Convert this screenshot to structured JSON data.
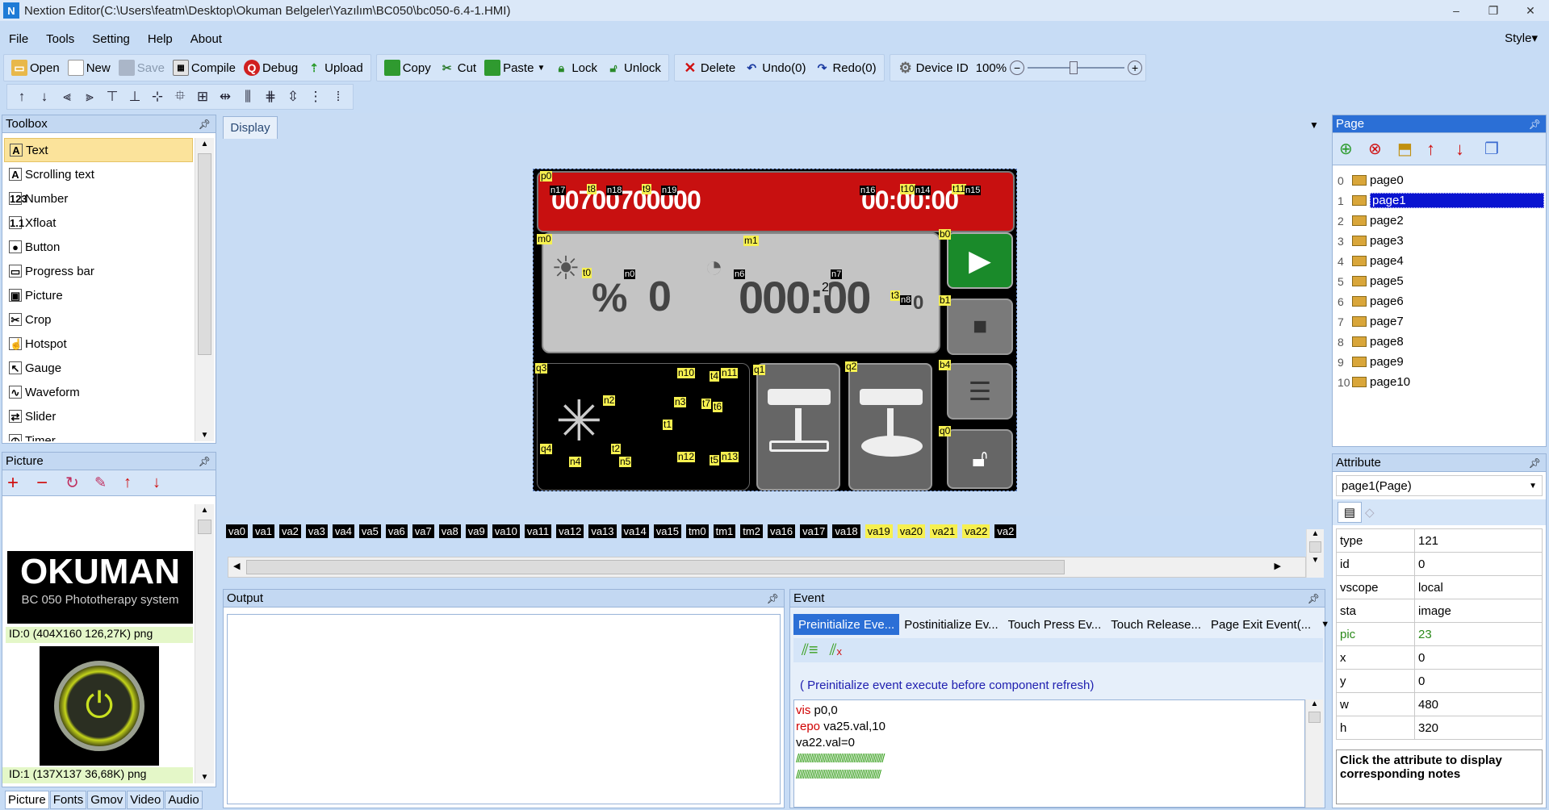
{
  "window": {
    "title": "Nextion Editor(C:\\Users\\featm\\Desktop\\Okuman Belgeler\\Yazılım\\BC050\\bc050-6.4-1.HMI)",
    "app_icon": "N",
    "minimize": "–",
    "maximize": "❐",
    "close": "✕"
  },
  "menu": {
    "file": "File",
    "tools": "Tools",
    "setting": "Setting",
    "help": "Help",
    "about": "About",
    "style": "Style▾"
  },
  "toolbar": {
    "open": "Open",
    "new": "New",
    "save": "Save",
    "compile": "Compile",
    "debug": "Debug",
    "upload": "Upload",
    "copy": "Copy",
    "cut": "Cut",
    "paste": "Paste",
    "lock": "Lock",
    "unlock": "Unlock",
    "delete": "Delete",
    "undo": "Undo(0)",
    "redo": "Redo(0)",
    "device_id": "Device  ID",
    "zoom": "100%"
  },
  "toolbox": {
    "title": "Toolbox",
    "items": [
      "Text",
      "Scrolling text",
      "Number",
      "Xfloat",
      "Button",
      "Progress bar",
      "Picture",
      "Crop",
      "Hotspot",
      "Gauge",
      "Waveform",
      "Slider",
      "Timer"
    ],
    "icons": [
      "A",
      "A",
      "123",
      "1.1",
      "●",
      "▭",
      "▣",
      "✂",
      "☝",
      "↖",
      "∿",
      "⇄",
      "◷"
    ]
  },
  "picture_panel": {
    "title": "Picture",
    "logo_text": "OKUMAN",
    "logo_subtitle": "BC 050 Phototherapy system",
    "pic0_caption": "ID:0  (404X160 126,27K) png",
    "pic1_caption": "ID:1  (137X137 36,68K) png"
  },
  "bottom_tabs": [
    "Picture",
    "Fonts",
    "Gmov",
    "Video",
    "Audio"
  ],
  "display": {
    "tab": "Display",
    "top_digits_left": "00700700000",
    "top_digits_right": "00:00:00",
    "pct_symbol": "%",
    "pct_value": "0",
    "time_value": "000:00",
    "sub_value": "2",
    "sub_value2": "0",
    "labels": {
      "p0": "p0",
      "n17": "n17",
      "t8": "t8",
      "n18": "n18",
      "t9": "t9",
      "n19": "n19",
      "n16": "n16",
      "t10": "t10",
      "n14": "n14",
      "t11": "t11",
      "n15": "n15",
      "m0": "m0",
      "m1": "m1",
      "t0": "t0",
      "n0": "n0",
      "n6": "n6",
      "n7": "n7",
      "t3": "t3",
      "n8": "n8",
      "b0": "b0",
      "b1": "b1",
      "q3": "q3",
      "n10": "n10",
      "t4": "t4",
      "n11": "n11",
      "n2": "n2",
      "n3": "n3",
      "t7": "t7",
      "t6": "t6",
      "t1": "t1",
      "q4": "q4",
      "n4": "n4",
      "t2": "t2",
      "n5": "n5",
      "n12": "n12",
      "t5": "t5",
      "n13": "n13",
      "q1": "q1",
      "q2": "q2",
      "b4": "b4",
      "q0": "q0"
    }
  },
  "variables": [
    {
      "name": "va0",
      "y": false
    },
    {
      "name": "va1",
      "y": false
    },
    {
      "name": "va2",
      "y": false
    },
    {
      "name": "va3",
      "y": false
    },
    {
      "name": "va4",
      "y": false
    },
    {
      "name": "va5",
      "y": false
    },
    {
      "name": "va6",
      "y": false
    },
    {
      "name": "va7",
      "y": false
    },
    {
      "name": "va8",
      "y": false
    },
    {
      "name": "va9",
      "y": false
    },
    {
      "name": "va10",
      "y": false
    },
    {
      "name": "va11",
      "y": false
    },
    {
      "name": "va12",
      "y": false
    },
    {
      "name": "va13",
      "y": false
    },
    {
      "name": "va14",
      "y": false
    },
    {
      "name": "va15",
      "y": false
    },
    {
      "name": "tm0",
      "y": false
    },
    {
      "name": "tm1",
      "y": false
    },
    {
      "name": "tm2",
      "y": false
    },
    {
      "name": "va16",
      "y": false
    },
    {
      "name": "va17",
      "y": false
    },
    {
      "name": "va18",
      "y": false
    },
    {
      "name": "va19",
      "y": true
    },
    {
      "name": "va20",
      "y": true
    },
    {
      "name": "va21",
      "y": true
    },
    {
      "name": "va22",
      "y": true
    },
    {
      "name": "va2",
      "y": false
    }
  ],
  "output": {
    "title": "Output"
  },
  "event": {
    "title": "Event",
    "tabs": [
      "Preinitialize Eve...",
      "Postinitialize Ev...",
      "Touch Press Ev...",
      "Touch Release...",
      "Page Exit Event(..."
    ],
    "note": "( Preinitialize event execute before component refresh)",
    "code": [
      {
        "kw": "vis",
        "rest": " p0,0"
      },
      {
        "kw": "repo",
        "rest": " va25.val,10"
      },
      {
        "kw": "",
        "rest": "va22.val=0"
      }
    ],
    "hatch1": "//////////////////////////////////////////////////",
    "hatch2": "////////////////////////////////////////////////"
  },
  "page_panel": {
    "title": "Page",
    "pages": [
      "page0",
      "page1",
      "page2",
      "page3",
      "page4",
      "page5",
      "page6",
      "page7",
      "page8",
      "page9",
      "page10"
    ],
    "selected": 1
  },
  "attribute": {
    "title": "Attribute",
    "selector": "page1(Page)",
    "rows": [
      {
        "k": "type",
        "v": "121",
        "green": false
      },
      {
        "k": "id",
        "v": "0",
        "green": false
      },
      {
        "k": "vscope",
        "v": "local",
        "green": false
      },
      {
        "k": "sta",
        "v": "image",
        "green": false
      },
      {
        "k": "pic",
        "v": "23",
        "green": true
      },
      {
        "k": "x",
        "v": "0",
        "green": false
      },
      {
        "k": "y",
        "v": "0",
        "green": false
      },
      {
        "k": "w",
        "v": "480",
        "green": false
      },
      {
        "k": "h",
        "v": "320",
        "green": false
      }
    ],
    "note": "Click the attribute to display corresponding notes"
  }
}
